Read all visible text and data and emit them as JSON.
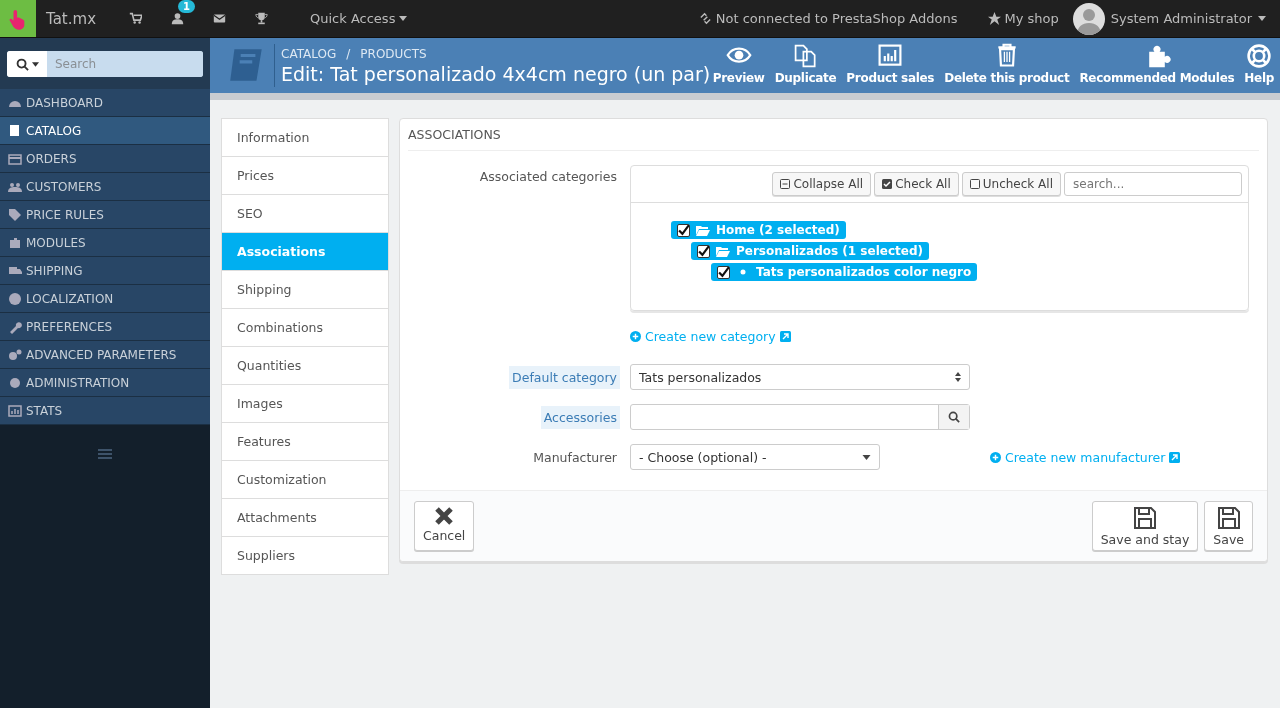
{
  "topbar": {
    "logo_text": "Tat.mx",
    "notification_count": "1",
    "quick_access": "Quick Access",
    "addons_status": "Not connected to PrestaShop Addons",
    "my_shop": "My shop",
    "user_name": "System Administrator"
  },
  "sidebar": {
    "search_placeholder": "Search",
    "items": [
      {
        "label": "DASHBOARD",
        "selected": false
      },
      {
        "label": "CATALOG",
        "selected": true
      },
      {
        "label": "ORDERS",
        "selected": false
      },
      {
        "label": "CUSTOMERS",
        "selected": false
      },
      {
        "label": "PRICE RULES",
        "selected": false
      },
      {
        "label": "MODULES",
        "selected": false
      },
      {
        "label": "SHIPPING",
        "selected": false
      },
      {
        "label": "LOCALIZATION",
        "selected": false
      },
      {
        "label": "PREFERENCES",
        "selected": false
      },
      {
        "label": "ADVANCED PARAMETERS",
        "selected": false
      },
      {
        "label": "ADMINISTRATION",
        "selected": false
      },
      {
        "label": "STATS",
        "selected": false
      }
    ]
  },
  "header": {
    "breadcrumb": [
      "CATALOG",
      "PRODUCTS"
    ],
    "breadcrumb_separator": "/",
    "title": "Edit: Tat personalizado 4x4cm negro (un par)",
    "actions": [
      {
        "label": "Preview"
      },
      {
        "label": "Duplicate"
      },
      {
        "label": "Product sales"
      },
      {
        "label": "Delete this product"
      },
      {
        "label": "Recommended Modules"
      },
      {
        "label": "Help"
      }
    ]
  },
  "tabs": [
    {
      "label": "Information",
      "selected": false
    },
    {
      "label": "Prices",
      "selected": false
    },
    {
      "label": "SEO",
      "selected": false
    },
    {
      "label": "Associations",
      "selected": true
    },
    {
      "label": "Shipping",
      "selected": false
    },
    {
      "label": "Combinations",
      "selected": false
    },
    {
      "label": "Quantities",
      "selected": false
    },
    {
      "label": "Images",
      "selected": false
    },
    {
      "label": "Features",
      "selected": false
    },
    {
      "label": "Customization",
      "selected": false
    },
    {
      "label": "Attachments",
      "selected": false
    },
    {
      "label": "Suppliers",
      "selected": false
    }
  ],
  "panel": {
    "title": "ASSOCIATIONS",
    "categories": {
      "label": "Associated categories",
      "tools": [
        {
          "label": "Collapse All"
        },
        {
          "label": "Check All"
        },
        {
          "label": "Uncheck All"
        }
      ],
      "search_placeholder": "search...",
      "tree": [
        {
          "label": "Home (2 selected)",
          "checked": true,
          "children": [
            {
              "label": "Personalizados (1 selected)",
              "checked": true,
              "children": [
                {
                  "label": "Tats personalizados color negro",
                  "checked": true
                }
              ]
            }
          ]
        }
      ],
      "create_link": "Create new category"
    },
    "fields": [
      {
        "kind": "select",
        "label": "Default category",
        "has_help": true,
        "value": "Tats personalizados"
      },
      {
        "kind": "search",
        "label": "Accessories",
        "has_help": true
      },
      {
        "kind": "dropdown",
        "label": "Manufacturer",
        "has_help": false,
        "value": "- Choose (optional) -",
        "link": "Create new manufacturer"
      }
    ],
    "footer": {
      "cancel": "Cancel",
      "save_and_stay": "Save and stay",
      "save": "Save"
    }
  }
}
